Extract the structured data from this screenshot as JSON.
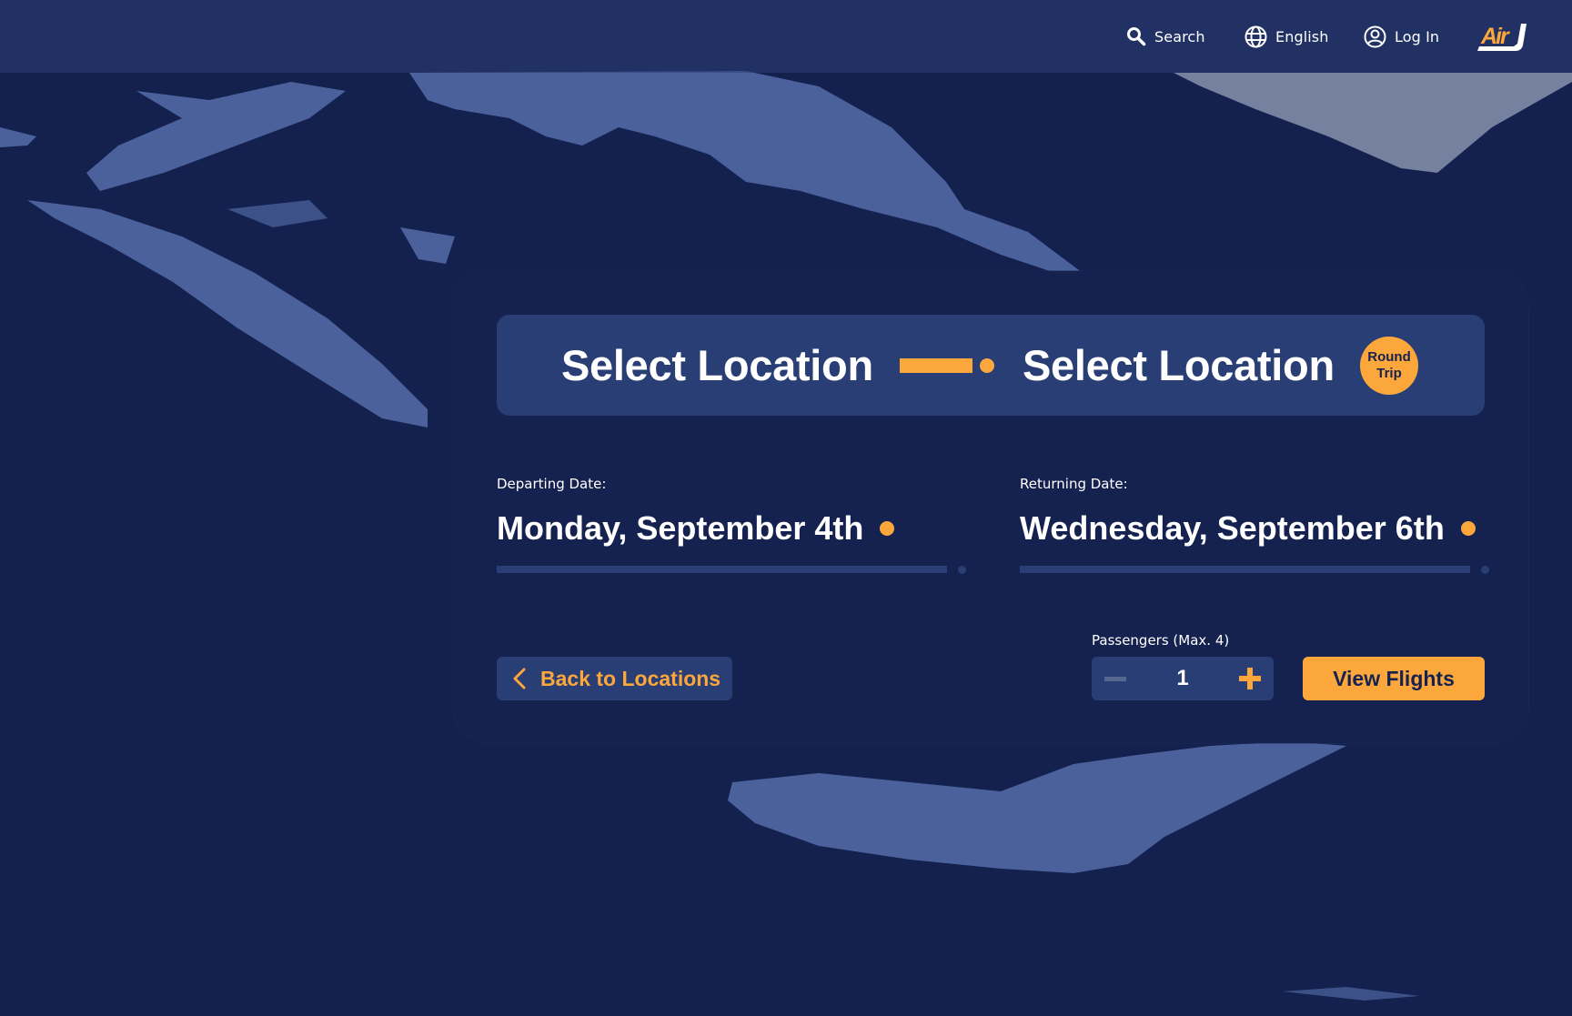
{
  "nav": {
    "search_label": "Search",
    "language_label": "English",
    "login_label": "Log In",
    "logo_text": "Air",
    "icons": {
      "search": "search-icon",
      "language": "globe-icon",
      "login": "user-circle-icon"
    }
  },
  "route": {
    "from_label": "Select Location",
    "to_label": "Select Location",
    "trip_type_line1": "Round",
    "trip_type_line2": "Trip"
  },
  "dates": {
    "departing_label": "Departing Date:",
    "departing_value": "Monday, September 4th",
    "returning_label": "Returning Date:",
    "returning_value": "Wednesday, September 6th"
  },
  "actions": {
    "back_label": "Back to Locations",
    "passengers_label": "Passengers (Max. 4)",
    "passengers_value": "1",
    "passengers_max": 4,
    "view_flights_label": "View Flights"
  },
  "colors": {
    "background": "#14214f",
    "card": "#152250",
    "panel": "#293e75",
    "accent": "#fba73c",
    "text": "#ffffff",
    "disabled": "#56688f"
  }
}
